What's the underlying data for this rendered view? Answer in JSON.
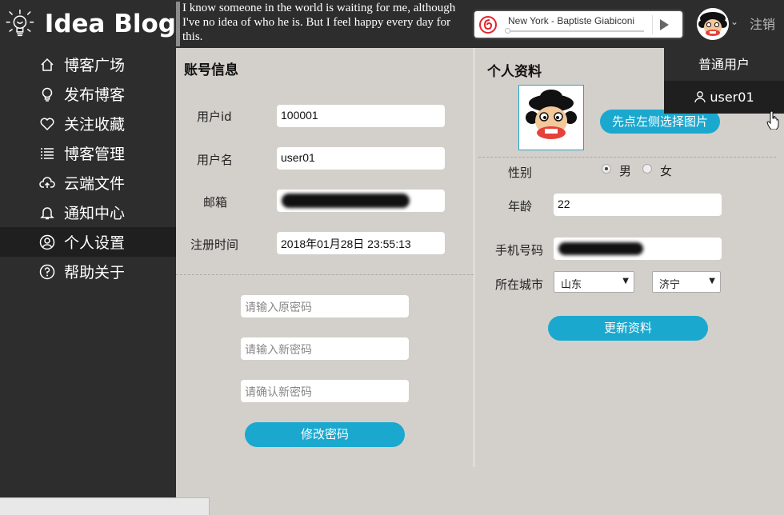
{
  "header": {
    "logo_text": "Idea Blog",
    "quote": "I know someone in the world is waiting for me, although I've no idea of who he is. But I feel happy every day for this.",
    "player_title": "New York - Baptiste Giabiconi",
    "logout_label": "注销"
  },
  "sidebar": {
    "items": [
      {
        "label": "博客广场",
        "icon": "home-icon"
      },
      {
        "label": "发布博客",
        "icon": "lightbulb-icon"
      },
      {
        "label": "关注收藏",
        "icon": "heart-icon"
      },
      {
        "label": "博客管理",
        "icon": "list-icon"
      },
      {
        "label": "云端文件",
        "icon": "cloud-upload-icon"
      },
      {
        "label": "通知中心",
        "icon": "bell-icon"
      },
      {
        "label": "个人设置",
        "icon": "user-icon",
        "active": true
      },
      {
        "label": "帮助关于",
        "icon": "help-icon"
      }
    ]
  },
  "account": {
    "title": "账号信息",
    "uid_label": "用户id",
    "uid_value": "100001",
    "username_label": "用户名",
    "username_value": "user01",
    "email_label": "邮箱",
    "regtime_label": "注册时间",
    "regtime_value": "2018年01月28日 23:55:13",
    "old_pwd_placeholder": "请输入原密码",
    "new_pwd_placeholder": "请输入新密码",
    "confirm_pwd_placeholder": "请确认新密码",
    "change_pwd_button": "修改密码"
  },
  "profile": {
    "title": "个人资料",
    "choose_image_button": "先点左侧选择图片",
    "gender_label": "性别",
    "gender_male": "男",
    "gender_female": "女",
    "gender_selected": "男",
    "age_label": "年龄",
    "age_value": "22",
    "phone_label": "手机号码",
    "city_label": "所在城市",
    "province_value": "山东",
    "city_value": "济宁",
    "update_button": "更新资料"
  },
  "user_menu": {
    "role": "普通用户",
    "username": "user01"
  },
  "colors": {
    "accent": "#1ba8cf",
    "dark_bg": "#2d2d2d",
    "content_bg": "#d3d0cb",
    "netease_red": "#e0262b"
  }
}
